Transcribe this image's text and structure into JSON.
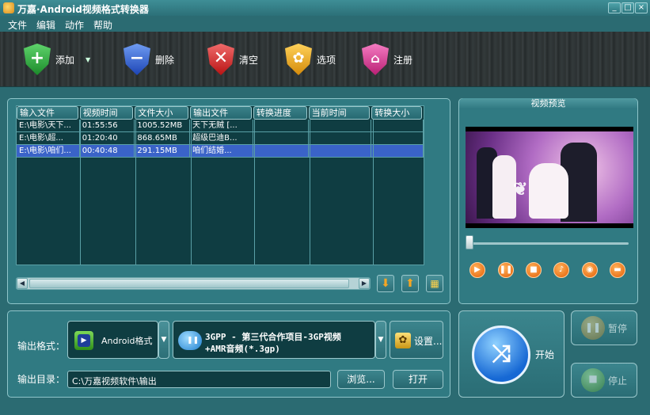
{
  "window": {
    "title": "万嘉·Android视频格式转换器",
    "min": "_",
    "max": "□",
    "close": "×"
  },
  "menu": [
    "文件",
    "编辑",
    "动作",
    "帮助"
  ],
  "toolbar": {
    "add": "添加",
    "remove": "删除",
    "clear": "清空",
    "options": "选项",
    "register": "注册",
    "colors": {
      "add": "#27a33a",
      "remove": "#2f5fd6",
      "clear": "#d42424",
      "options": "#e9a916",
      "register": "#d8358f"
    }
  },
  "list": {
    "headers": [
      "输入文件",
      "视频时间",
      "文件大小",
      "输出文件",
      "转换进度",
      "当前时间",
      "转换大小"
    ],
    "rows": [
      [
        "E:\\电影\\天下...",
        "01:55:56",
        "1005.52MB",
        "天下无贼 [...",
        "",
        "",
        ""
      ],
      [
        "E:\\电影\\超...",
        "01:20:40",
        "868.65MB",
        "超级巴迪B...",
        "",
        "",
        ""
      ],
      [
        "E:\\电影\\咱们...",
        "00:40:48",
        "291.15MB",
        "咱们结婚...",
        "",
        "",
        ""
      ]
    ],
    "selected_row": 2
  },
  "preview": {
    "title": "视频预览"
  },
  "output": {
    "format_label": "输出格式：",
    "profile": "Android格式",
    "format_line1": "3GPP  -  第三代合作项目-3GP视频",
    "format_line2": "+AMR音频(*.3gp)",
    "settings": "设置...",
    "dir_label": "输出目录：",
    "dir_value": "C:\\万嘉视频软件\\输出",
    "browse": "浏览...",
    "open": "打开"
  },
  "actions": {
    "start": "开始",
    "pause": "暂停",
    "stop": "停止"
  }
}
